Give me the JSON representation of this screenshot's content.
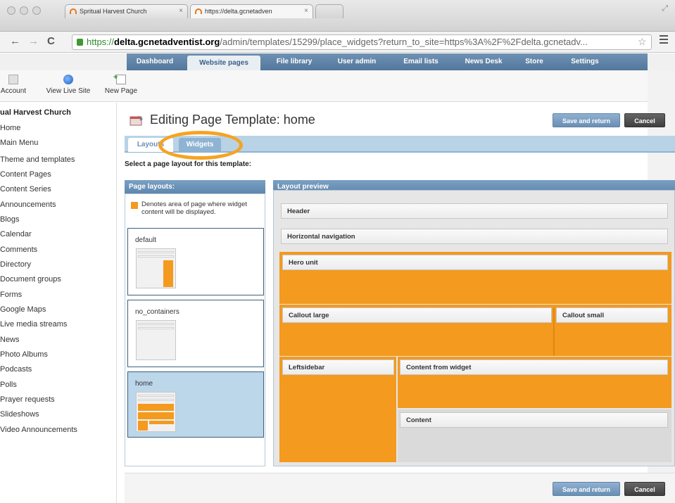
{
  "browser": {
    "tabs": [
      {
        "label": "Spritual Harvest Church"
      },
      {
        "label": "https://delta.gcnetadven"
      }
    ],
    "url": {
      "protocol": "https://",
      "host": "delta.gcnetadventist.org",
      "path": "/admin/templates/15299/place_widgets?return_to_site=https%3A%2F%2Fdelta.gcnetadv..."
    }
  },
  "app_nav": {
    "tabs": [
      "Dashboard",
      "Website pages",
      "File library",
      "User admin",
      "Email lists",
      "News Desk",
      "Store",
      "Settings"
    ],
    "active": "Website pages"
  },
  "quick_actions": [
    {
      "label": "Account",
      "icon": "account-icon"
    },
    {
      "label": "View Live Site",
      "icon": "globe-icon"
    },
    {
      "label": "New Page",
      "icon": "new-page-icon"
    }
  ],
  "sidebar": {
    "title": "ual Harvest Church",
    "items": [
      "Home",
      "Main Menu",
      "Theme and templates",
      "Content Pages",
      "Content Series",
      "Announcements",
      "Blogs",
      "Calendar",
      "Comments",
      "Directory",
      "Document groups",
      "Forms",
      "Google Maps",
      "Live media streams",
      "News",
      "Photo Albums",
      "Podcasts",
      "Polls",
      "Prayer requests",
      "Slideshows",
      "Video Announcements"
    ]
  },
  "page": {
    "title": "Editing Page Template: home",
    "save_label": "Save and return",
    "cancel_label": "Cancel",
    "subtabs": [
      "Layouts",
      "Widgets"
    ],
    "active_subtab": "Widgets",
    "instruction": "Select a page layout for this template:"
  },
  "layouts_panel": {
    "heading": "Page layouts:",
    "legend": "Denotes area of page where widget content will be displayed.",
    "layouts": [
      "default",
      "no_containers",
      "home"
    ],
    "selected": "home"
  },
  "preview_panel": {
    "heading": "Layout preview",
    "zones": {
      "header": "Header",
      "horizontal_nav": "Horizontal navigation",
      "hero": "Hero unit",
      "callout_large": "Callout large",
      "callout_small": "Callout small",
      "leftsidebar": "Leftsidebar",
      "content_from_widget": "Content from widget",
      "content": "Content"
    }
  },
  "colors": {
    "widget_orange": "#f39a1f",
    "highlight_ring": "#f6a322",
    "nav_blue": "#5f86ad"
  }
}
